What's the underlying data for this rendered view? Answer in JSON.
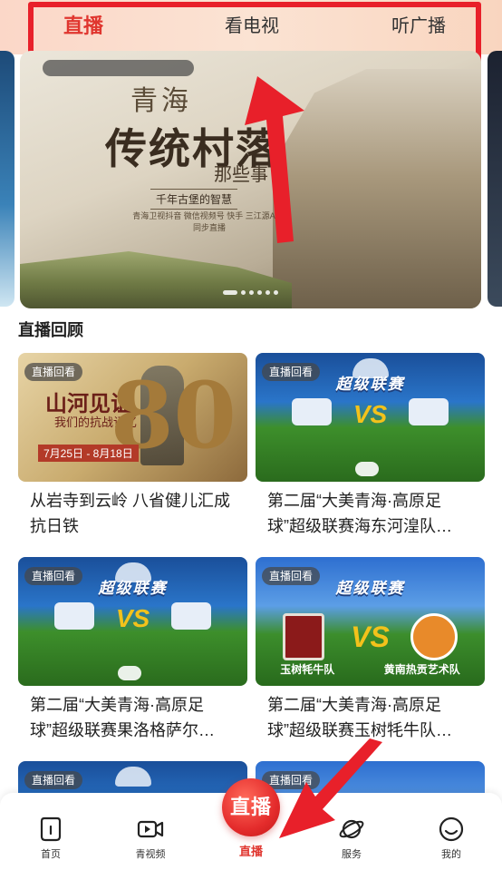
{
  "top_tabs": {
    "live": "直播",
    "tv": "看电视",
    "radio": "听广播",
    "active": "live"
  },
  "banner": {
    "title_line1": "青海",
    "title_line2": "传统村落",
    "title_line3": "那些事",
    "subtitle": "千年古堡的智慧",
    "caption": "青海卫视抖音 微信视频号 快手 三江源APP 同步直播",
    "slide_index": 1,
    "slide_count": 6
  },
  "section": {
    "title": "直播回顾"
  },
  "cards": [
    {
      "badge": "直播回看",
      "title": "从岩寺到云岭 八省健儿汇成抗日铁",
      "thumb_text_main": "山河见证",
      "thumb_text_sub": "我们的抗战记忆",
      "thumb_number": "80",
      "thumb_date": "7月25日 - 8月18日"
    },
    {
      "badge": "直播回看",
      "title": "第二届“大美青海·高原足球”超级联赛海东河湟队…",
      "league": "超级联赛",
      "vs": "VS"
    },
    {
      "badge": "直播回看",
      "title": "第二届“大美青海·高原足球”超级联赛果洛格萨尔…",
      "league": "超级联赛",
      "vs": "VS"
    },
    {
      "badge": "直播回看",
      "title": "第二届“大美青海·高原足球”超级联赛玉树牦牛队…",
      "league": "超级联赛",
      "vs": "VS",
      "team_left": "玉树牦牛队",
      "team_right": "黄南热贡艺术队"
    },
    {
      "badge": "直播回看"
    },
    {
      "badge": "直播回看"
    }
  ],
  "bottom_nav": {
    "home": "首页",
    "video": "青视频",
    "live_button": "直播",
    "live_label": "直播",
    "service": "服务",
    "me": "我的"
  },
  "colors": {
    "accent_red": "#e0362f",
    "annotation_red": "#e8202a"
  },
  "icons": [
    "home-icon",
    "video-icon",
    "planet-icon",
    "smile-icon"
  ]
}
